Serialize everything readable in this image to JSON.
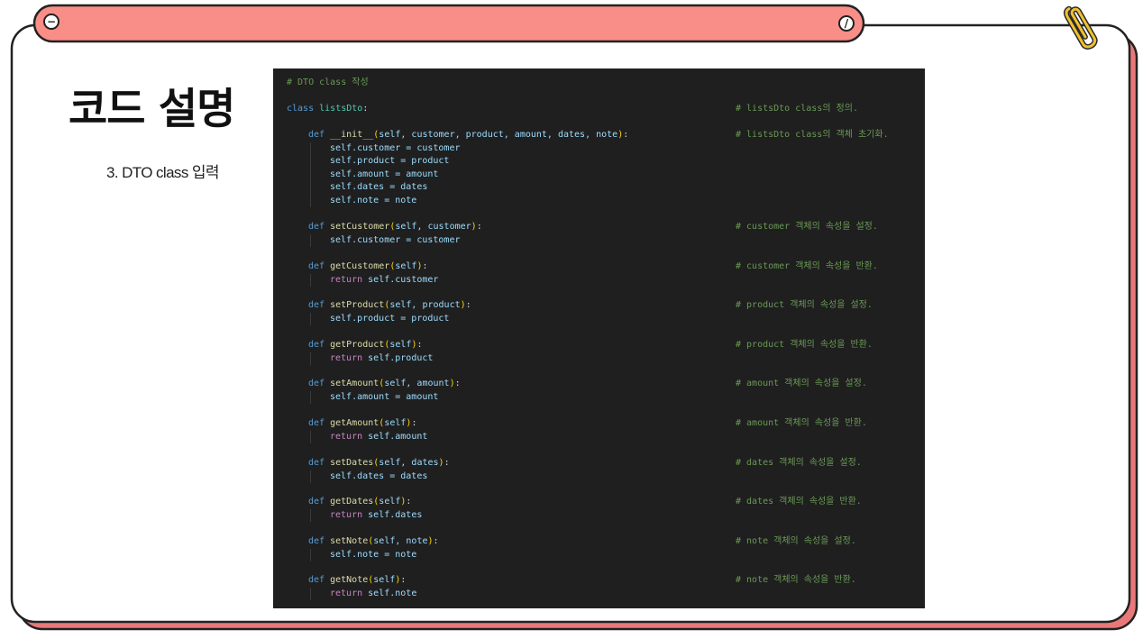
{
  "slide": {
    "title": "코드 설명",
    "subtitle": "3. DTO class 입력"
  },
  "colors": {
    "title_bar": "#f98d87",
    "frame_border": "#222222",
    "frame_shadow": "#e9787a",
    "code_bg": "#1f1f1f",
    "comment": "#6a9955",
    "keyword": "#569cd6",
    "class_name": "#4ec9b0",
    "function_name": "#dcdcaa",
    "parameter": "#9cdcfe",
    "bracket": "#ffd700",
    "return_keyword": "#c586c0",
    "paperclip": "#f0c030"
  },
  "icons": {
    "left": "minus-circle-icon",
    "right": "slash-circle-icon",
    "corner": "paperclip-icon"
  },
  "code": {
    "header_comment": "# DTO class 작성",
    "class_kw": "class",
    "class_name": "listsDto",
    "class_colon": ":",
    "class_comment": "# listsDto class의 정의.",
    "init": {
      "def_kw": "def",
      "name": "__init__",
      "open": "(",
      "params": "self, customer, product, amount, dates, note",
      "close": ")",
      "colon": ":",
      "comment": "# listsDto class의 객체 초기화.",
      "body": [
        "self.customer = customer",
        "self.product = product",
        "self.amount = amount",
        "self.dates = dates",
        "self.note = note"
      ]
    },
    "methods": [
      {
        "def_kw": "def",
        "name": "setCustomer",
        "open": "(",
        "params": "self, customer",
        "close": ")",
        "colon": ":",
        "body": "self.customer = customer",
        "is_return": false,
        "comment": "# customer 객체의 속성을 설정."
      },
      {
        "def_kw": "def",
        "name": "getCustomer",
        "open": "(",
        "params": "self",
        "close": ")",
        "colon": ":",
        "return_kw": "return",
        "body": "self.customer",
        "is_return": true,
        "comment": "# customer 객체의 속성을 반환."
      },
      {
        "def_kw": "def",
        "name": "setProduct",
        "open": "(",
        "params": "self, product",
        "close": ")",
        "colon": ":",
        "body": "self.product = product",
        "is_return": false,
        "comment": "# product 객체의 속성을 설정."
      },
      {
        "def_kw": "def",
        "name": "getProduct",
        "open": "(",
        "params": "self",
        "close": ")",
        "colon": ":",
        "return_kw": "return",
        "body": "self.product",
        "is_return": true,
        "comment": "# product 객체의 속성을 반환."
      },
      {
        "def_kw": "def",
        "name": "setAmount",
        "open": "(",
        "params": "self, amount",
        "close": ")",
        "colon": ":",
        "body": "self.amount = amount",
        "is_return": false,
        "comment": "# amount 객체의 속성을 설정."
      },
      {
        "def_kw": "def",
        "name": "getAmount",
        "open": "(",
        "params": "self",
        "close": ")",
        "colon": ":",
        "return_kw": "return",
        "body": "self.amount",
        "is_return": true,
        "comment": "# amount 객체의 속성을 반환."
      },
      {
        "def_kw": "def",
        "name": "setDates",
        "open": "(",
        "params": "self, dates",
        "close": ")",
        "colon": ":",
        "body": "self.dates = dates",
        "is_return": false,
        "comment": "# dates 객체의 속성을 설정."
      },
      {
        "def_kw": "def",
        "name": "getDates",
        "open": "(",
        "params": "self",
        "close": ")",
        "colon": ":",
        "return_kw": "return",
        "body": "self.dates",
        "is_return": true,
        "comment": "# dates 객체의 속성을 반환."
      },
      {
        "def_kw": "def",
        "name": "setNote",
        "open": "(",
        "params": "self, note",
        "close": ")",
        "colon": ":",
        "body": "self.note = note",
        "is_return": false,
        "comment": "# note 객체의 속성을 설정."
      },
      {
        "def_kw": "def",
        "name": "getNote",
        "open": "(",
        "params": "self",
        "close": ")",
        "colon": ":",
        "return_kw": "return",
        "body": "self.note",
        "is_return": true,
        "comment": "# note 객체의 속성을 반환."
      }
    ]
  }
}
